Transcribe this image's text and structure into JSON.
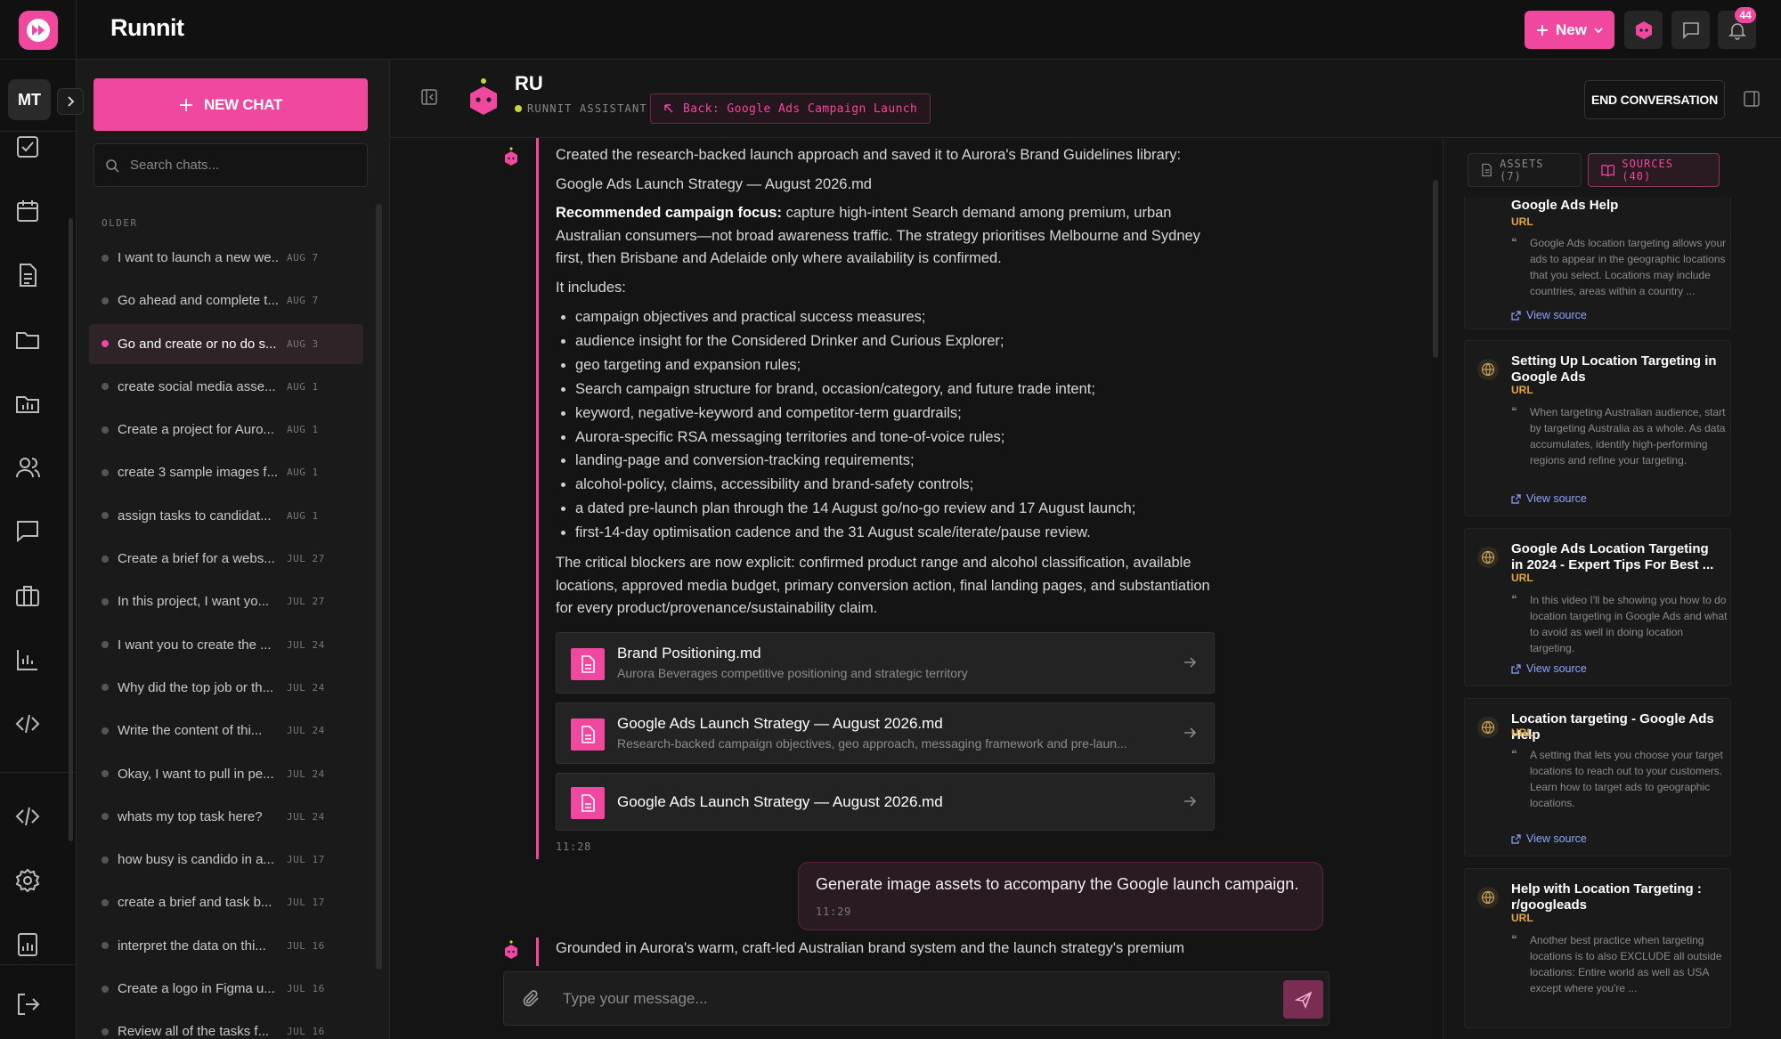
{
  "app": {
    "brand": "Runnit"
  },
  "topbar": {
    "new_label": "New",
    "notification_count": "44"
  },
  "rail": {
    "avatar_initials": "MT",
    "icons": [
      "tasks-icon",
      "calendar-icon",
      "document-icon",
      "folder-icon",
      "dashboard-icon",
      "users-icon",
      "chat-icon",
      "briefcase-icon",
      "chart-icon",
      "code-icon",
      "embed-icon",
      "settings-icon",
      "reports-icon",
      "logout-icon"
    ]
  },
  "chatlist": {
    "new_chat_label": "NEW CHAT",
    "search_placeholder": "Search chats...",
    "section_label": "OLDER",
    "items": [
      {
        "title": "I want to launch a new we...",
        "date": "AUG 7"
      },
      {
        "title": "Go ahead and complete t...",
        "date": "AUG 7"
      },
      {
        "title": "Go and create or no do s...",
        "date": "AUG 3",
        "active": true
      },
      {
        "title": "create social media asse...",
        "date": "AUG 1"
      },
      {
        "title": "Create a project for Auro...",
        "date": "AUG 1"
      },
      {
        "title": "create 3 sample images f...",
        "date": "AUG 1"
      },
      {
        "title": "assign tasks to candidat...",
        "date": "AUG 1"
      },
      {
        "title": "Create a brief for a webs...",
        "date": "JUL 27"
      },
      {
        "title": "In this project, I want yo...",
        "date": "JUL 27"
      },
      {
        "title": "I want you to create the ...",
        "date": "JUL 24"
      },
      {
        "title": "Why did the top job or th...",
        "date": "JUL 24"
      },
      {
        "title": "Write the content of thi...",
        "date": "JUL 24"
      },
      {
        "title": "Okay, I want to pull in pe...",
        "date": "JUL 24"
      },
      {
        "title": "whats my top task here?",
        "date": "JUL 24"
      },
      {
        "title": "how busy is candido in a...",
        "date": "JUL 17"
      },
      {
        "title": "create a brief and task b...",
        "date": "JUL 17"
      },
      {
        "title": "interpret the data on thi...",
        "date": "JUL 16"
      },
      {
        "title": "Create a logo in Figma u...",
        "date": "JUL 16"
      },
      {
        "title": "Review all of the tasks f...",
        "date": "JUL 16"
      }
    ]
  },
  "conversation": {
    "assistant_name": "RU",
    "assistant_role": "RUNNIT ASSISTANT",
    "back_label": "Back: Google Ads Campaign Launch",
    "end_label": "END CONVERSATION"
  },
  "messages": {
    "m1": {
      "p1": "Created the research-backed launch approach and saved it to Aurora's Brand Guidelines library:",
      "p2": "Google Ads Launch Strategy — August 2026.md",
      "focus_label": "Recommended campaign focus:",
      "focus_text": " capture high-intent Search demand among premium, urban Australian consumers—not broad awareness traffic. The strategy prioritises Melbourne and Sydney first, then Brisbane and Adelaide only where availability is confirmed.",
      "includes": "It includes:",
      "bullets": [
        "campaign objectives and practical success measures;",
        "audience insight for the Considered Drinker and Curious Explorer;",
        "geo targeting and expansion rules;",
        "Search campaign structure for brand, occasion/category, and future trade intent;",
        "keyword, negative-keyword and competitor-term guardrails;",
        "Aurora-specific RSA messaging territories and tone-of-voice rules;",
        "landing-page and conversion-tracking requirements;",
        "alcohol-policy, claims, accessibility and brand-safety controls;",
        "a dated pre-launch plan through the 14 August go/no-go review and 17 August launch;",
        "first-14-day optimisation cadence and the 31 August scale/iterate/pause review."
      ],
      "blockers": "The critical blockers are now explicit: confirmed product range and alcohol classification, available locations, approved media budget, primary conversion action, final landing pages, and substantiation for every product/provenance/sustainability claim.",
      "cards": [
        {
          "title": "Brand Positioning.md",
          "subtitle": "Aurora Beverages competitive positioning and strategic territory"
        },
        {
          "title": "Google Ads Launch Strategy — August 2026.md",
          "subtitle": "Research-backed campaign objectives, geo approach, messaging framework and pre-laun..."
        },
        {
          "title": "Google Ads Launch Strategy — August 2026.md",
          "subtitle": ""
        }
      ],
      "time": "11:28"
    },
    "user": {
      "text": "Generate image assets to accompany the Google launch campaign.",
      "time": "11:29"
    },
    "m2": {
      "text": "Grounded in Aurora's warm, craft-led Australian brand system and the launch strategy's premium"
    }
  },
  "composer": {
    "placeholder": "Type your message..."
  },
  "sources_panel": {
    "assets_tab": "ASSETS (7)",
    "sources_tab": "SOURCES (40)",
    "items": [
      {
        "title": "Google Ads Help",
        "type": "URL",
        "excerpt": "Google Ads location targeting allows your ads to appear in the geographic locations that you select. Locations may include countries, areas within a country ...",
        "link": "View source"
      },
      {
        "title": "Setting Up Location Targeting in Google Ads",
        "type": "URL",
        "excerpt": "When targeting Australian audience, start by targeting Australia as a whole. As data accumulates, identify high-performing regions and refine your targeting.",
        "link": "View source"
      },
      {
        "title": "Google Ads Location Targeting in 2024 - Expert Tips For Best ...",
        "type": "URL",
        "excerpt": "In this video I'll be showing you how to do location targeting in Google Ads and what to avoid as well in doing location targeting.",
        "link": "View source"
      },
      {
        "title": "Location targeting - Google Ads Help",
        "type": "URL",
        "excerpt": "A setting that lets you choose your target locations to reach out to your customers. Learn how to target ads to geographic locations.",
        "link": "View source"
      },
      {
        "title": "Help with Location Targeting : r/googleads",
        "type": "URL",
        "excerpt": "Another best practice when targeting locations is to also EXCLUDE all outside locations: Entire world as well as USA except where you're ...",
        "link": ""
      }
    ]
  },
  "colors": {
    "accent": "#f0489e",
    "background": "#141414",
    "source_type": "#e3a53d",
    "link": "#8aa4ff"
  }
}
